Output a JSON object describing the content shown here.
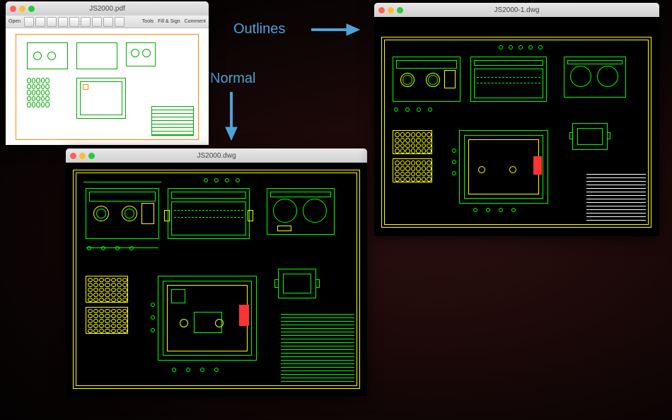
{
  "labels": {
    "outlines": "Outlines",
    "normal": "Normal"
  },
  "windows": {
    "pdf": {
      "title": "JS2000.pdf",
      "toolbar": {
        "tools": "Tools",
        "fill_sign": "Fill & Sign",
        "comment": "Comment",
        "open": "Open"
      }
    },
    "dwg_normal": {
      "title": "JS2000.dwg"
    },
    "dwg_outlines": {
      "title": "JS2000-1.dwg"
    }
  },
  "colors": {
    "green": "#00ff00",
    "yellow": "#ffff00",
    "orange": "#ff8800",
    "cyan": "#00dddd",
    "white": "#ffffff",
    "arrow": "#4ba3d8"
  }
}
